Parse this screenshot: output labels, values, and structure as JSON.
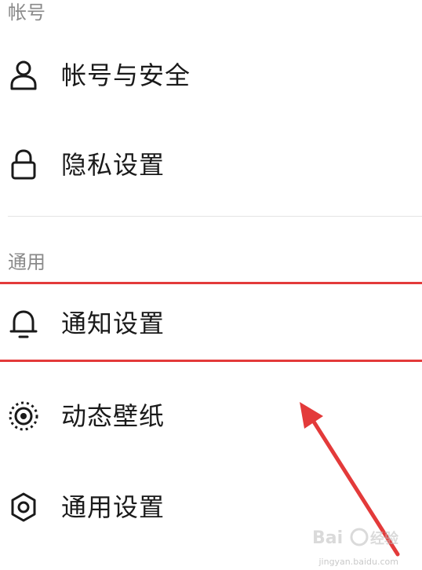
{
  "sections": {
    "account": {
      "header": "帐号",
      "items": [
        {
          "label": "帐号与安全",
          "icon": "user-icon"
        },
        {
          "label": "隐私设置",
          "icon": "lock-icon"
        }
      ]
    },
    "general": {
      "header": "通用",
      "items": [
        {
          "label": "通知设置",
          "icon": "bell-icon"
        },
        {
          "label": "动态壁纸",
          "icon": "dynamic-wallpaper-icon"
        },
        {
          "label": "通用设置",
          "icon": "gear-icon"
        }
      ]
    }
  },
  "annotation": {
    "highlight_color": "#e33a3a",
    "highlighted_item": "通知设置"
  },
  "watermark": {
    "text": "Baidu 经验",
    "subtext": "jingyan.baidu.com"
  }
}
